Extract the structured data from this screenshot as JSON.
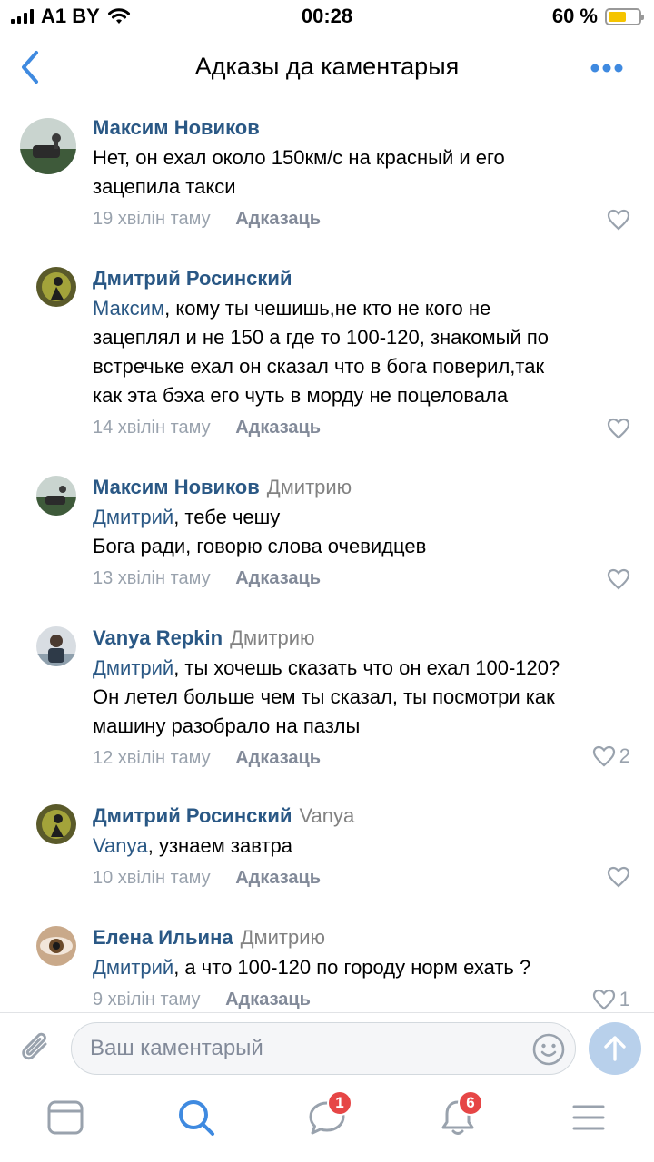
{
  "status_bar": {
    "carrier": "A1 BY",
    "time": "00:28",
    "battery_text": "60 %",
    "battery_level": 0.6
  },
  "header": {
    "title": "Адказы да каментарыя",
    "back_icon": "chevron-left-icon",
    "more_icon": "more-horizontal-icon"
  },
  "comments": [
    {
      "author": "Максим Новиков",
      "reply_to": "",
      "mention": "",
      "text_lines": [
        "Нет, он ехал около 150км/с на красный и его",
        "зацепила такси"
      ],
      "time": "19 хвілін таму",
      "reply_label": "Адказаць",
      "likes": ""
    },
    {
      "author": "Дмитрий Росинский",
      "reply_to": "",
      "mention": "Максим",
      "text_lines": [
        ", кому ты чешишь,не кто не кого не",
        "зацеплял и не 150 а где то 100-120, знакомый по",
        "встречьке ехал он сказал что в бога поверил,так",
        "как эта бэха его чуть в морду не поцеловала"
      ],
      "time": "14 хвілін таму",
      "reply_label": "Адказаць",
      "likes": ""
    },
    {
      "author": "Максим Новиков",
      "reply_to": "Дмитрию",
      "mention": "Дмитрий",
      "text_lines": [
        ", тебе чешу",
        "Бога ради, говорю слова очевидцев"
      ],
      "time": "13 хвілін таму",
      "reply_label": "Адказаць",
      "likes": ""
    },
    {
      "author": "Vanya Repkin",
      "reply_to": "Дмитрию",
      "mention": "Дмитрий",
      "text_lines": [
        ", ты хочешь сказать что он ехал 100-120?",
        "Он летел больше чем ты сказал, ты посмотри как",
        "машину разобрало на пазлы"
      ],
      "time": "12 хвілін таму",
      "reply_label": "Адказаць",
      "likes": "2"
    },
    {
      "author": "Дмитрий Росинский",
      "reply_to": "Vanya",
      "mention": "Vanya",
      "text_lines": [
        ", узнаем завтра"
      ],
      "time": "10 хвілін таму",
      "reply_label": "Адказаць",
      "likes": ""
    },
    {
      "author": "Елена Ильина",
      "reply_to": "Дмитрию",
      "mention": "Дмитрий",
      "text_lines": [
        ", а что 100-120 по городу норм ехать ?"
      ],
      "time": "9 хвілін таму",
      "reply_label": "Адказаць",
      "likes": "1"
    }
  ],
  "composer": {
    "placeholder": "Ваш каментарый",
    "attach_icon": "paperclip-icon",
    "emoji_icon": "smile-icon",
    "send_icon": "arrow-up-icon"
  },
  "tab_bar": {
    "messages_badge": "1",
    "notifications_badge": "6",
    "icons": [
      "newsfeed-icon",
      "search-icon",
      "messages-icon",
      "notifications-icon",
      "menu-icon"
    ]
  },
  "colors": {
    "link": "#2a5885",
    "accent": "#3f8ae0",
    "badge": "#e64646",
    "meta": "#99a2ad"
  }
}
